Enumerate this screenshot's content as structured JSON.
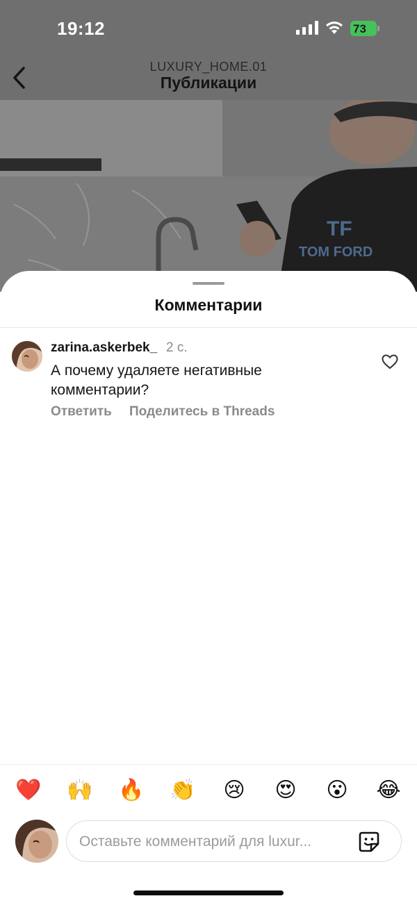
{
  "status_bar": {
    "time": "19:12",
    "battery": "73"
  },
  "nav": {
    "subtitle": "LUXURY_HOME.01",
    "title": "Публикации"
  },
  "sheet": {
    "title": "Комментарии"
  },
  "comments": [
    {
      "username": "zarina.askerbek_",
      "time": "2 с.",
      "text": "А почему удаляете негативные комментарии?",
      "reply_label": "Ответить",
      "share_label": "Поделитесь в Threads"
    }
  ],
  "reactions": [
    "❤️",
    "🙌",
    "🔥",
    "👏",
    "😢",
    "😍",
    "😮",
    "😂"
  ],
  "composer": {
    "placeholder": "Оставьте комментарий для luxur..."
  },
  "colors": {
    "battery": "#45c25a",
    "muted_text": "#8a8a8a"
  }
}
